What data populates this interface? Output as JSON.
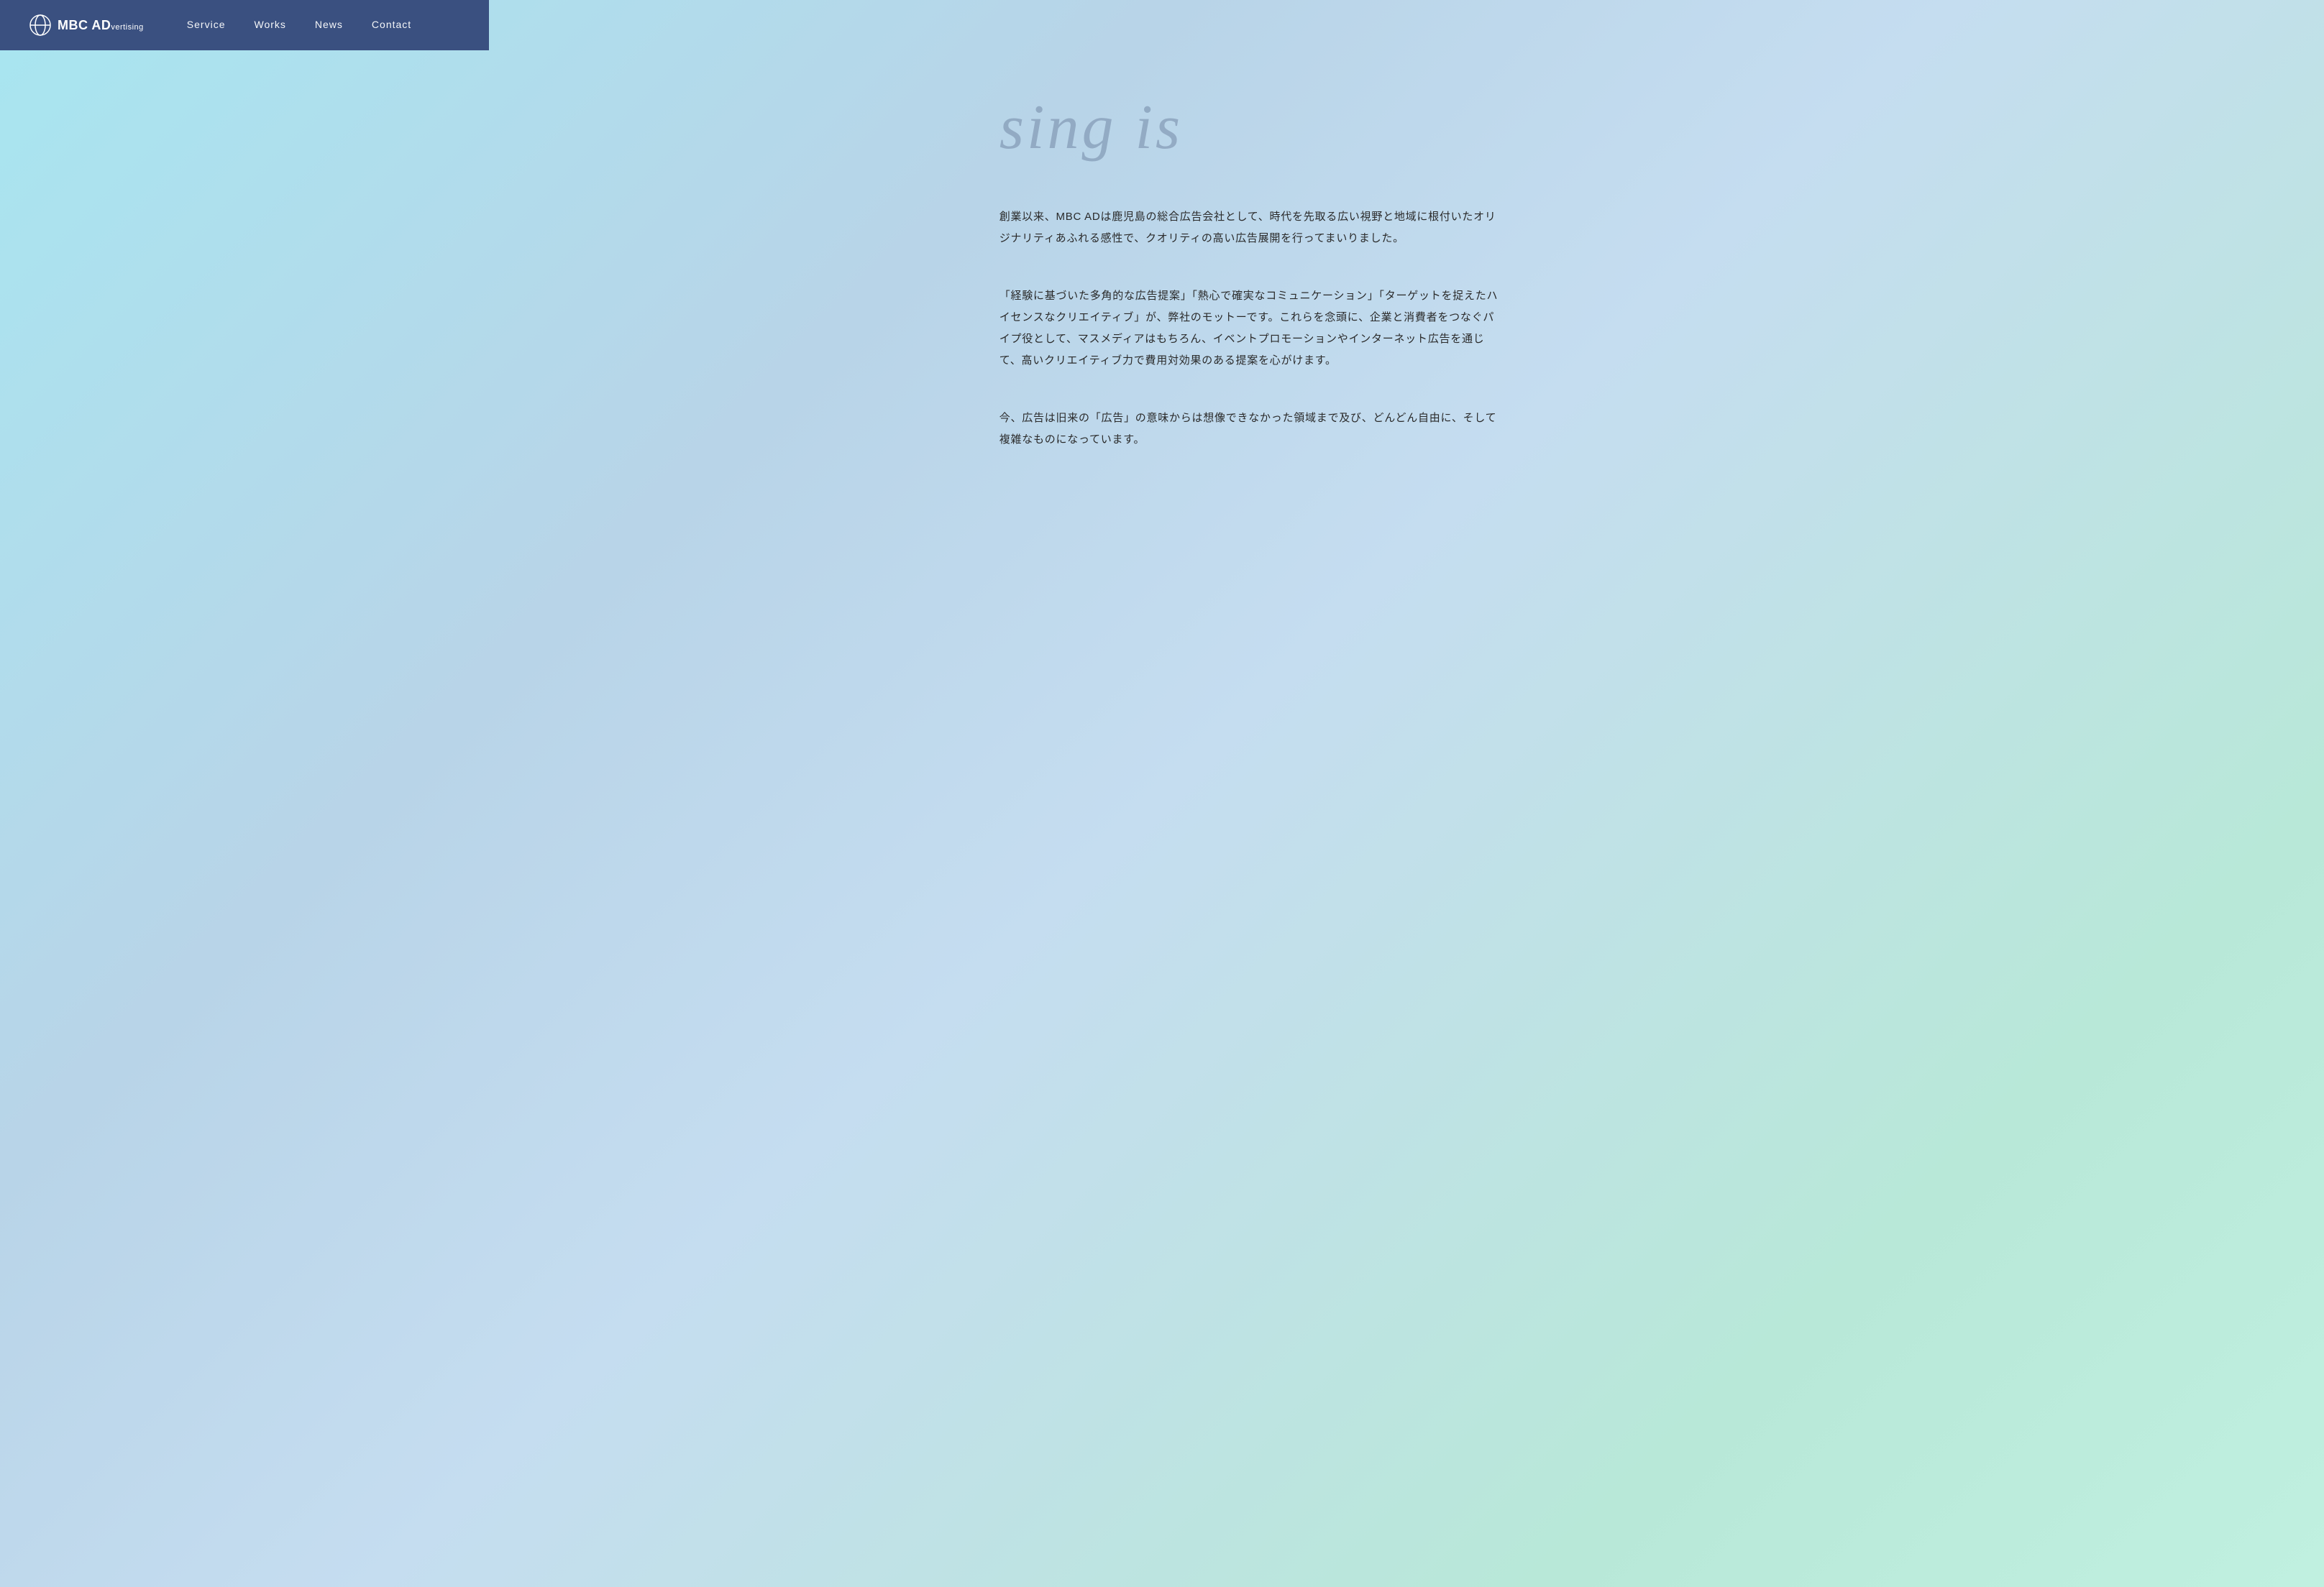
{
  "nav": {
    "logo": {
      "text": "MBC AD",
      "subtext": "vertising",
      "aria": "MBC ADvertising"
    },
    "links": [
      {
        "label": "Service",
        "href": "#service"
      },
      {
        "label": "Works",
        "href": "#works"
      },
      {
        "label": "News",
        "href": "#news"
      },
      {
        "label": "Contact",
        "href": "#contact"
      }
    ]
  },
  "hero": {
    "text": "sing is"
  },
  "sections": [
    {
      "id": "intro",
      "content": "創業以来、MBC ADは鹿児島の総合広告会社として、時代を先取る広い視野と地域に根付いたオリジナリティあふれる感性で、クオリティの高い広告展開を行ってまいりました。"
    },
    {
      "id": "motto",
      "content": "「経験に基づいた多角的な広告提案」「熱心で確実なコミュニケーション」「ターゲットを捉えたハイセンスなクリエイティブ」が、弊社のモットーです。これらを念頭に、企業と消費者をつなぐパイプ役として、マスメディアはもちろん、イベントプロモーションやインターネット広告を通じて、高いクリエイティブ力で費用対効果のある提案を心がけます。"
    },
    {
      "id": "vision",
      "content": "今、広告は旧来の「広告」の意味からは想像できなかった領域まで及び、どんどん自由に、そして複雑なものになっています。"
    }
  ]
}
